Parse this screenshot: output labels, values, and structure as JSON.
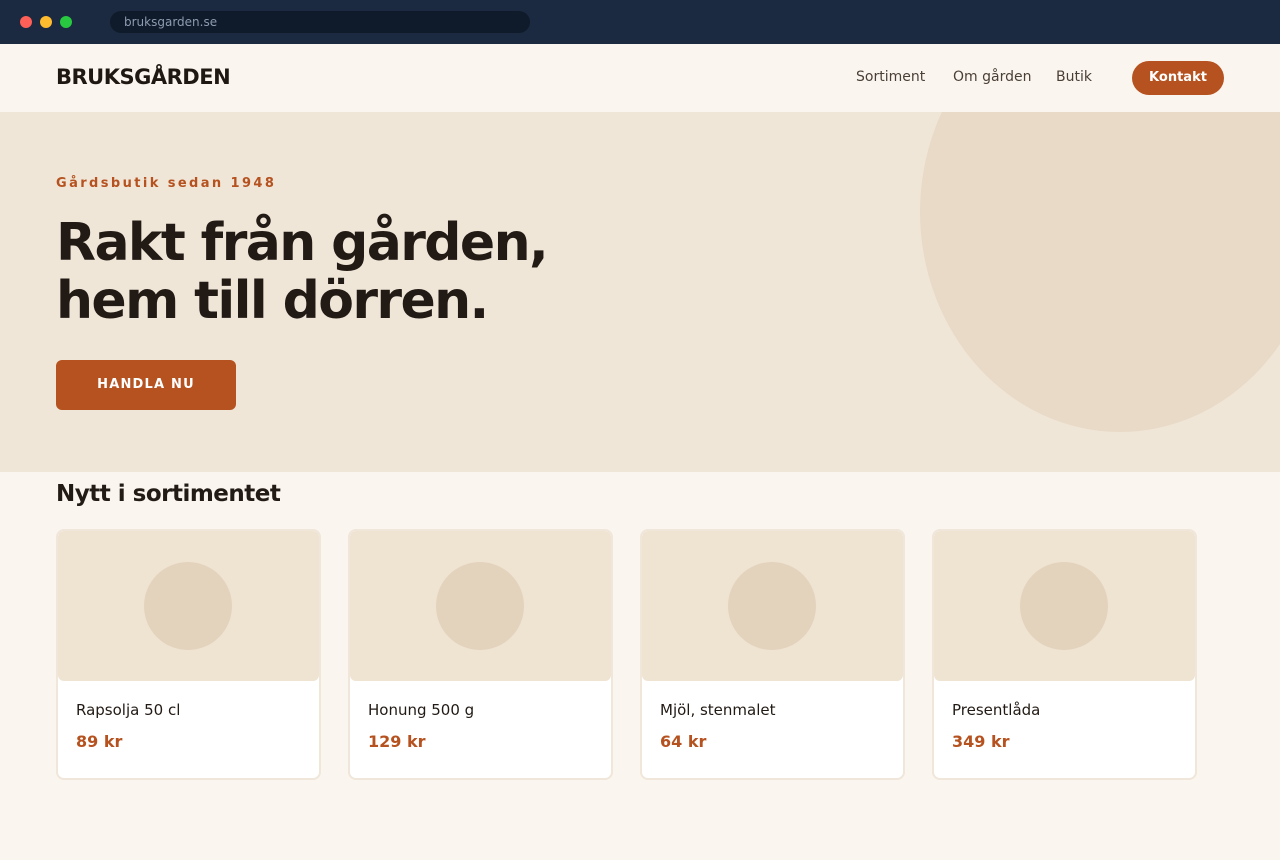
{
  "browser": {
    "url": "bruksgarden.se"
  },
  "nav": {
    "brand": "BRUKSGÅRDEN",
    "links": [
      "Sortiment",
      "Om gården",
      "Butik"
    ],
    "contact_label": "Kontakt"
  },
  "hero": {
    "eyebrow": "Gårdsbutik sedan 1948",
    "headline_line1": "Rakt från gården,",
    "headline_line2": "hem till dörren.",
    "cta_label": "HANDLA NU"
  },
  "products": {
    "title": "Nytt i sortimentet",
    "items": [
      {
        "name": "Rapsolja 50 cl",
        "price": "89 kr"
      },
      {
        "name": "Honung 500 g",
        "price": "129 kr"
      },
      {
        "name": "Mjöl, stenmalet",
        "price": "64 kr"
      },
      {
        "name": "Presentlåda",
        "price": "349 kr"
      }
    ]
  },
  "colors": {
    "accent": "#b5521f",
    "hero_bg": "#f0e6d8",
    "chrome": "#1b2a40"
  }
}
